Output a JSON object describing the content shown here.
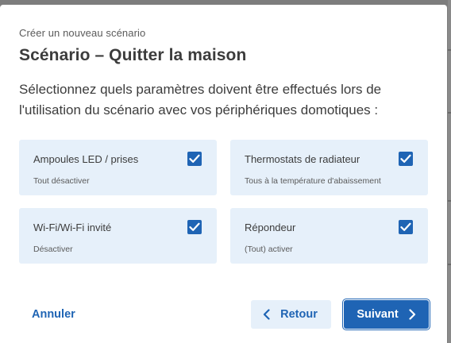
{
  "dialog": {
    "subtitle": "Créer un nouveau scénario",
    "title": "Scénario – Quitter la maison",
    "description": "Sélectionnez quels paramètres doivent être effectués lors de l'utilisation du scénario avec vos périphériques domotiques :"
  },
  "options": [
    {
      "label": "Ampoules LED / prises",
      "sub": "Tout désactiver",
      "checked": true
    },
    {
      "label": "Thermostats de radiateur",
      "sub": "Tous à la température d'abaissement",
      "checked": true
    },
    {
      "label": "Wi-Fi/Wi-Fi invité",
      "sub": "Désactiver",
      "checked": true
    },
    {
      "label": "Répondeur",
      "sub": "(Tout) activer",
      "checked": true
    }
  ],
  "actions": {
    "cancel_label": "Annuler",
    "back_label": "Retour",
    "next_label": "Suivant"
  },
  "colors": {
    "accent": "#1f64b4",
    "card_bg": "#e6f0fa",
    "text": "#3c3c3c"
  },
  "icons": {
    "checkbox": "checkmark-icon",
    "back": "chevron-left-icon",
    "next": "chevron-right-icon"
  }
}
